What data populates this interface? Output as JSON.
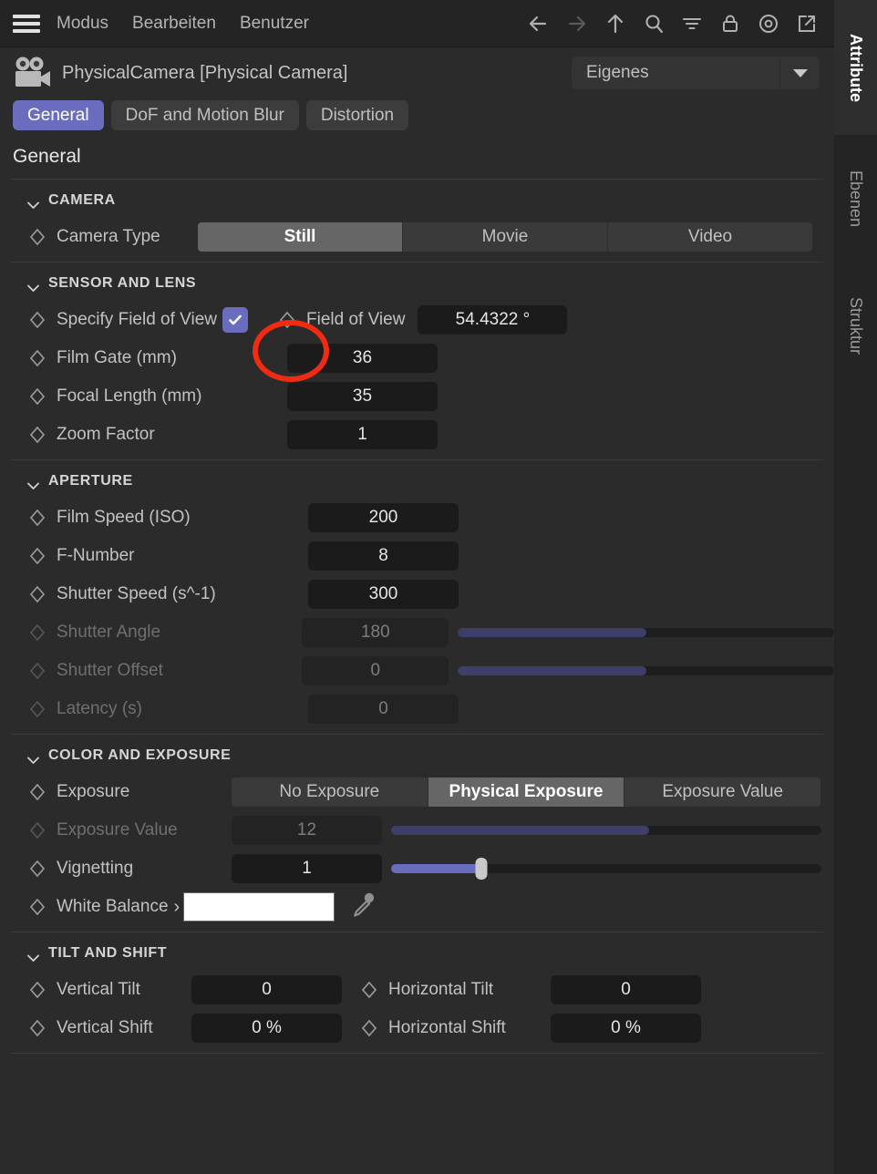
{
  "menubar": {
    "hamburger": "menu-icon",
    "items": [
      {
        "label": "Modus"
      },
      {
        "label": "Bearbeiten"
      },
      {
        "label": "Benutzer"
      }
    ],
    "icons": [
      {
        "name": "arrow-left-icon"
      },
      {
        "name": "arrow-right-icon"
      },
      {
        "name": "arrow-up-icon"
      },
      {
        "name": "search-icon"
      },
      {
        "name": "filter-icon"
      },
      {
        "name": "lock-icon"
      },
      {
        "name": "record-icon"
      },
      {
        "name": "open-external-icon"
      }
    ]
  },
  "object_header": {
    "icon": "movie-camera-icon",
    "title": "PhysicalCamera [Physical Camera]",
    "mode_select": {
      "value": "Eigenes"
    }
  },
  "tabs": [
    {
      "label": "General",
      "active": true
    },
    {
      "label": "DoF and Motion Blur",
      "active": false
    },
    {
      "label": "Distortion",
      "active": false
    }
  ],
  "panel": {
    "title": "General",
    "groups": {
      "camera": {
        "name": "CAMERA",
        "camera_type": {
          "label": "Camera Type",
          "options": [
            "Still",
            "Movie",
            "Video"
          ],
          "selected": "Still"
        }
      },
      "sensor_and_lens": {
        "name": "SENSOR AND LENS",
        "specify_fov": {
          "label": "Specify Field of View",
          "checked": true
        },
        "field_of_view": {
          "label": "Field of View",
          "value": "54.4322 °"
        },
        "film_gate": {
          "label": "Film Gate (mm)",
          "value": "36"
        },
        "focal_length": {
          "label": "Focal Length (mm)",
          "value": "35"
        },
        "zoom_factor": {
          "label": "Zoom Factor",
          "value": "1"
        }
      },
      "aperture": {
        "name": "APERTURE",
        "film_speed": {
          "label": "Film Speed (ISO)",
          "value": "200"
        },
        "f_number": {
          "label": "F-Number",
          "value": "8"
        },
        "shutter_speed": {
          "label": "Shutter Speed (s^-1)",
          "value": "300"
        },
        "shutter_angle": {
          "label": "Shutter Angle",
          "value": "180",
          "slider_pct": 50
        },
        "shutter_offset": {
          "label": "Shutter Offset",
          "value": "0",
          "slider_pct": 50
        },
        "latency": {
          "label": "Latency (s)",
          "value": "0"
        }
      },
      "color_and_exposure": {
        "name": "COLOR AND EXPOSURE",
        "exposure": {
          "label": "Exposure",
          "options": [
            "No Exposure",
            "Physical Exposure",
            "Exposure Value"
          ],
          "selected": "Physical Exposure"
        },
        "exposure_value": {
          "label": "Exposure Value",
          "value": "12",
          "slider_pct": 60
        },
        "vignetting": {
          "label": "Vignetting",
          "value": "1",
          "slider_pct": 21
        },
        "white_balance": {
          "label": "White Balance",
          "color": "#ffffff",
          "picker": "eyedropper-icon"
        }
      },
      "tilt_and_shift": {
        "name": "TILT AND SHIFT",
        "vertical_tilt": {
          "label": "Vertical Tilt",
          "value": "0"
        },
        "horizontal_tilt": {
          "label": "Horizontal Tilt",
          "value": "0"
        },
        "vertical_shift": {
          "label": "Vertical Shift",
          "value": "0 %"
        },
        "horizontal_shift": {
          "label": "Horizontal Shift",
          "value": "0 %"
        }
      }
    }
  },
  "rail": {
    "tabs": [
      {
        "label": "Attribute",
        "active": true
      },
      {
        "label": "Ebenen",
        "active": false
      },
      {
        "label": "Struktur",
        "active": false
      }
    ]
  },
  "annotation": {
    "color": "#f02b12",
    "target": "specify-field-of-view-checkbox"
  },
  "theme": {
    "accent": "#6a6cbd",
    "background": "#2b2b2b",
    "field_background": "#1b1b1b"
  }
}
